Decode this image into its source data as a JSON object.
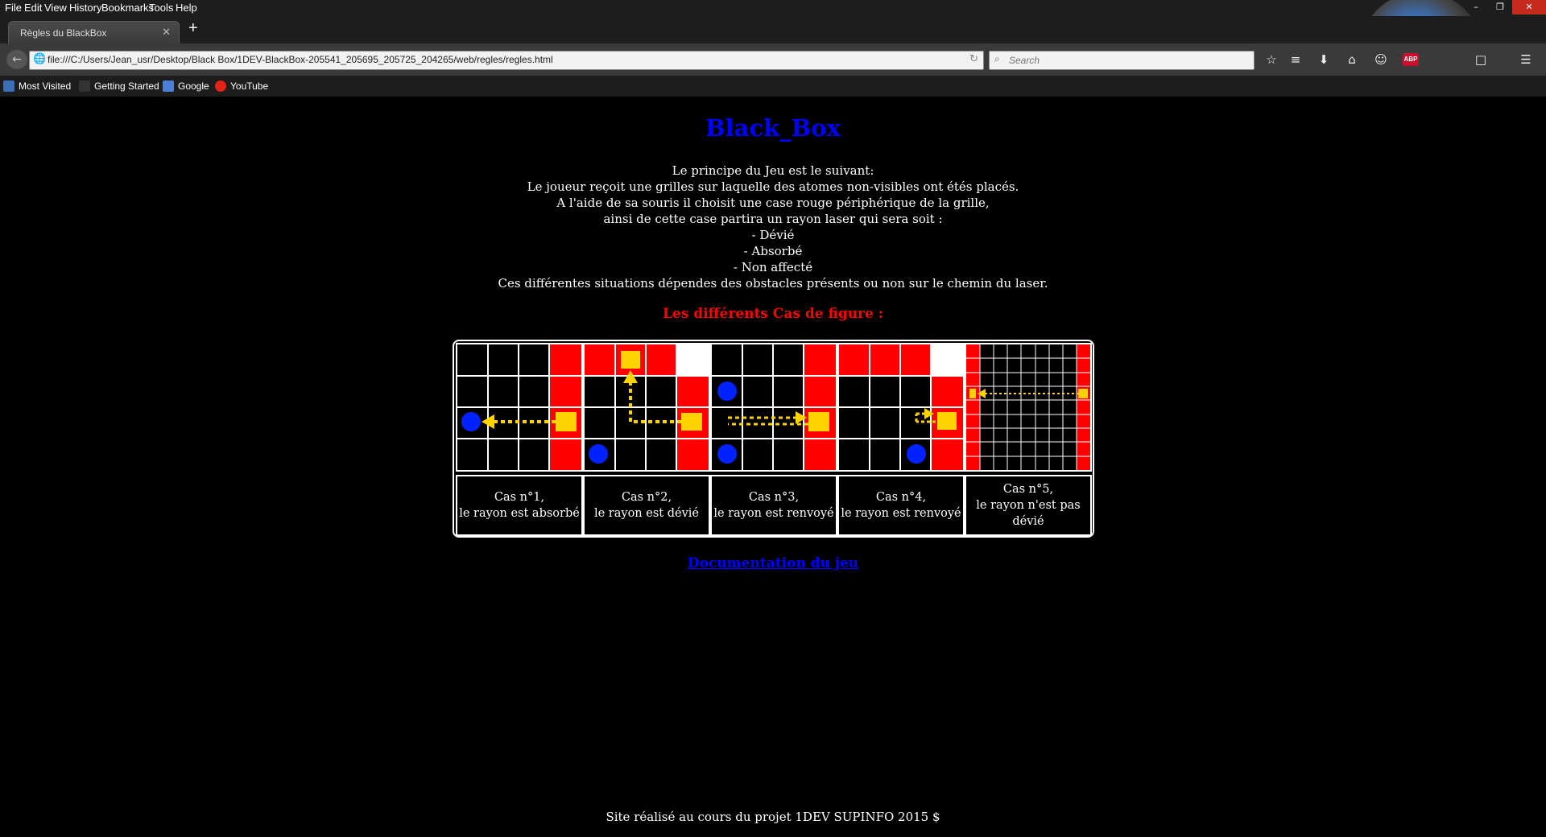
{
  "browser": {
    "menu": [
      "File",
      "Edit",
      "View",
      "History",
      "Bookmarks",
      "Tools",
      "Help"
    ],
    "tab_title": "Règles du BlackBox",
    "url": "file:///C:/Users/Jean_usr/Desktop/Black Box/1DEV-BlackBox-205541_205695_205725_204265/web/regles/regles.html",
    "search_placeholder": "Search",
    "bookmarks": [
      "Most Visited",
      "Getting Started",
      "Google",
      "YouTube"
    ]
  },
  "page": {
    "title": "Black_Box",
    "intro_lines": [
      "Le principe du Jeu est le suivant:",
      "Le joueur reçoit une grilles sur laquelle des atomes non-visibles ont étés placés.",
      "A l'aide de sa souris il choisit une case rouge périphérique de la grille,",
      "ainsi de cette case partira un rayon laser qui sera soit :",
      "- Dévié",
      "- Absorbé",
      "- Non affecté",
      "Ces différentes situations dépendes des obstacles présents ou non sur le chemin du laser."
    ],
    "cases_heading": "Les différents Cas de figure :",
    "cases": [
      {
        "line1": "Cas n°1,",
        "line2": "le rayon est absorbé"
      },
      {
        "line1": "Cas n°2,",
        "line2": "le rayon est dévié"
      },
      {
        "line1": "Cas n°3,",
        "line2": "le rayon est renvoyé"
      },
      {
        "line1": "Cas n°4,",
        "line2": "le rayon est renvoyé"
      },
      {
        "line1": "Cas n°5,",
        "line2": "le rayon n'est pas dévié"
      }
    ],
    "doc_link": "Documentation du jeu",
    "footer": "Site réalisé au cours du projet 1DEV SUPINFO 2015 $"
  },
  "colors": {
    "title": "#0000ff",
    "heading": "#ff0000",
    "grid_red": "#ff0000",
    "atom_blue": "#0022ff",
    "laser_yellow": "#ffd200"
  },
  "icons": {
    "back": "back-arrow-icon",
    "site": "globe-icon",
    "reload": "reload-icon",
    "search": "search-icon",
    "bookmark": "star-icon",
    "reading_list": "list-icon",
    "downloads": "download-icon",
    "home": "home-icon",
    "chat": "chat-icon",
    "adblock": "adblock-icon",
    "menu": "hamburger-menu-icon"
  }
}
